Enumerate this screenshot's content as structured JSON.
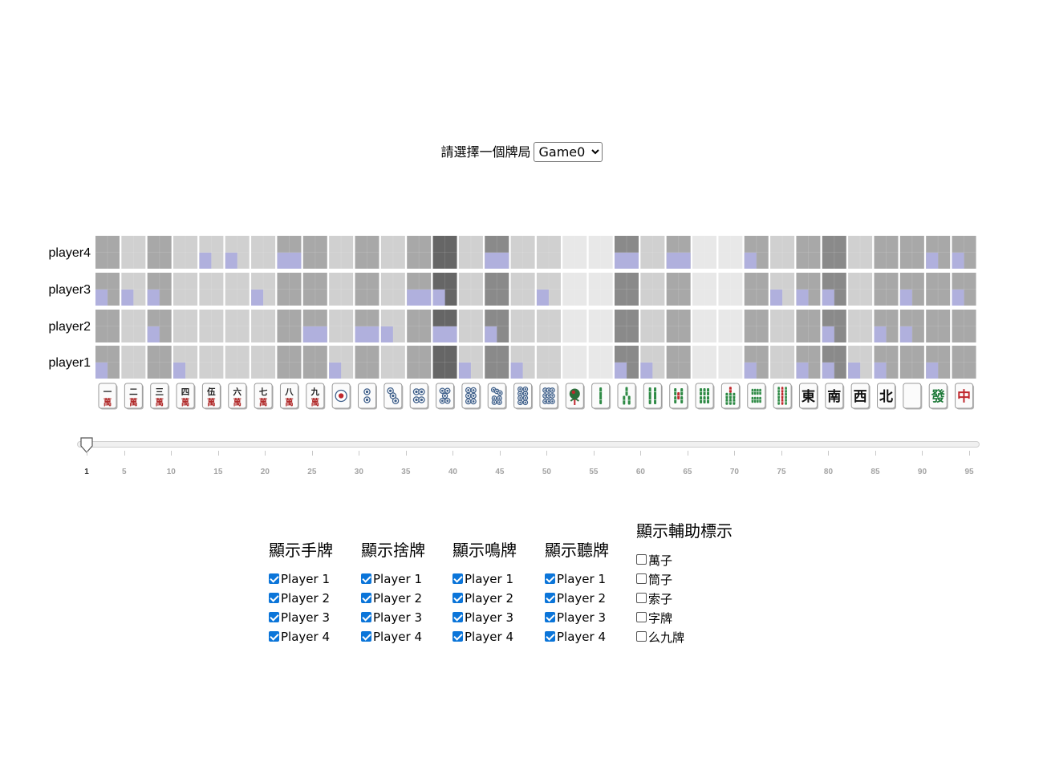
{
  "game_select": {
    "label": "請選擇一個牌局",
    "selected": "Game0",
    "options": [
      "Game0"
    ]
  },
  "heatmap": {
    "players": [
      "player4",
      "player3",
      "player2",
      "player1"
    ],
    "tiles": [
      {
        "name": "1萬",
        "top": "一",
        "bottom": "萬",
        "kind": "man"
      },
      {
        "name": "2萬",
        "top": "二",
        "bottom": "萬",
        "kind": "man"
      },
      {
        "name": "3萬",
        "top": "三",
        "bottom": "萬",
        "kind": "man"
      },
      {
        "name": "4萬",
        "top": "四",
        "bottom": "萬",
        "kind": "man"
      },
      {
        "name": "5萬",
        "top": "伍",
        "bottom": "萬",
        "kind": "man"
      },
      {
        "name": "6萬",
        "top": "六",
        "bottom": "萬",
        "kind": "man"
      },
      {
        "name": "7萬",
        "top": "七",
        "bottom": "萬",
        "kind": "man"
      },
      {
        "name": "8萬",
        "top": "八",
        "bottom": "萬",
        "kind": "man"
      },
      {
        "name": "9萬",
        "top": "九",
        "bottom": "萬",
        "kind": "man"
      },
      {
        "name": "1筒",
        "count": 1,
        "kind": "pin"
      },
      {
        "name": "2筒",
        "count": 2,
        "kind": "pin"
      },
      {
        "name": "3筒",
        "count": 3,
        "kind": "pin"
      },
      {
        "name": "4筒",
        "count": 4,
        "kind": "pin"
      },
      {
        "name": "5筒",
        "count": 5,
        "kind": "pin"
      },
      {
        "name": "6筒",
        "count": 6,
        "kind": "pin"
      },
      {
        "name": "7筒",
        "count": 7,
        "kind": "pin"
      },
      {
        "name": "8筒",
        "count": 8,
        "kind": "pin"
      },
      {
        "name": "9筒",
        "count": 9,
        "kind": "pin"
      },
      {
        "name": "1索",
        "count": 1,
        "kind": "sou"
      },
      {
        "name": "2索",
        "count": 2,
        "kind": "sou"
      },
      {
        "name": "3索",
        "count": 3,
        "kind": "sou"
      },
      {
        "name": "4索",
        "count": 4,
        "kind": "sou"
      },
      {
        "name": "5索",
        "count": 5,
        "kind": "sou"
      },
      {
        "name": "6索",
        "count": 6,
        "kind": "sou"
      },
      {
        "name": "7索",
        "count": 7,
        "kind": "sou"
      },
      {
        "name": "8索",
        "count": 8,
        "kind": "sou"
      },
      {
        "name": "9索",
        "count": 9,
        "kind": "sou"
      },
      {
        "name": "東",
        "char": "東",
        "kind": "honor",
        "color": "#111111"
      },
      {
        "name": "南",
        "char": "南",
        "kind": "honor",
        "color": "#111111"
      },
      {
        "name": "西",
        "char": "西",
        "kind": "honor",
        "color": "#111111"
      },
      {
        "name": "北",
        "char": "北",
        "kind": "honor",
        "color": "#111111"
      },
      {
        "name": "白",
        "char": "",
        "kind": "honor",
        "color": "#111111"
      },
      {
        "name": "發",
        "char": "發",
        "kind": "honor",
        "color": "#1f7a3a"
      },
      {
        "name": "中",
        "char": "中",
        "kind": "honor",
        "color": "#c0282d"
      }
    ],
    "column_shade": [
      2,
      1,
      2,
      1,
      1,
      1,
      1,
      2,
      2,
      1,
      2,
      1,
      2,
      4,
      1,
      3,
      1,
      1,
      0,
      0,
      3,
      1,
      2,
      0,
      0,
      2,
      1,
      2,
      3,
      1,
      2,
      2,
      2,
      2
    ],
    "marks": {
      "player4": [
        [
          4,
          1
        ],
        [
          5,
          1
        ],
        [
          7,
          2
        ],
        [
          15,
          2
        ],
        [
          20,
          2
        ],
        [
          22,
          2
        ],
        [
          25,
          1
        ],
        [
          32,
          1
        ],
        [
          33,
          1
        ]
      ],
      "player3": [
        [
          0,
          1
        ],
        [
          1,
          1
        ],
        [
          2,
          1
        ],
        [
          6,
          1
        ],
        [
          12,
          2
        ],
        [
          13,
          1
        ],
        [
          17,
          1
        ],
        [
          26,
          1
        ],
        [
          27,
          1
        ],
        [
          28,
          1
        ],
        [
          31,
          1
        ],
        [
          33,
          1
        ]
      ],
      "player2": [
        [
          2,
          1
        ],
        [
          8,
          2
        ],
        [
          10,
          2
        ],
        [
          11,
          1
        ],
        [
          13,
          2
        ],
        [
          15,
          1
        ],
        [
          28,
          1
        ],
        [
          30,
          1
        ],
        [
          31,
          1
        ]
      ],
      "player1": [
        [
          0,
          1
        ],
        [
          3,
          1
        ],
        [
          9,
          1
        ],
        [
          14,
          1
        ],
        [
          16,
          1
        ],
        [
          20,
          1
        ],
        [
          21,
          1
        ],
        [
          25,
          1
        ],
        [
          27,
          1
        ],
        [
          28,
          1
        ],
        [
          29,
          1
        ],
        [
          30,
          1
        ],
        [
          32,
          1
        ]
      ]
    },
    "colors": {
      "shade_0": "#e8e8e8",
      "shade_1": "#d0d0d0",
      "shade_2": "#a8a8a8",
      "shade_3": "#8a8a8a",
      "shade_4": "#666666",
      "mark": "#b0b0dd",
      "man_red": "#b02a2a",
      "pin_blue": "#3e5f8a",
      "sou_green": "#2e8a45"
    }
  },
  "slider": {
    "min": 1,
    "max": 95,
    "value": 1,
    "ticks": [
      1,
      5,
      10,
      15,
      20,
      25,
      30,
      35,
      40,
      45,
      50,
      55,
      60,
      65,
      70,
      75,
      80,
      85,
      90,
      95
    ]
  },
  "controls": [
    {
      "title": "顯示手牌",
      "options": [
        {
          "label": "Player 1",
          "checked": true
        },
        {
          "label": "Player 2",
          "checked": true
        },
        {
          "label": "Player 3",
          "checked": true
        },
        {
          "label": "Player 4",
          "checked": true
        }
      ]
    },
    {
      "title": "顯示捨牌",
      "options": [
        {
          "label": "Player 1",
          "checked": true
        },
        {
          "label": "Player 2",
          "checked": true
        },
        {
          "label": "Player 3",
          "checked": true
        },
        {
          "label": "Player 4",
          "checked": true
        }
      ]
    },
    {
      "title": "顯示鳴牌",
      "options": [
        {
          "label": "Player 1",
          "checked": true
        },
        {
          "label": "Player 2",
          "checked": true
        },
        {
          "label": "Player 3",
          "checked": true
        },
        {
          "label": "Player 4",
          "checked": true
        }
      ]
    },
    {
      "title": "顯示聽牌",
      "options": [
        {
          "label": "Player 1",
          "checked": true
        },
        {
          "label": "Player 2",
          "checked": true
        },
        {
          "label": "Player 3",
          "checked": true
        },
        {
          "label": "Player 4",
          "checked": true
        }
      ]
    },
    {
      "title": "顯示輔助標示",
      "options": [
        {
          "label": "萬子",
          "checked": false
        },
        {
          "label": "筒子",
          "checked": false
        },
        {
          "label": "索子",
          "checked": false
        },
        {
          "label": "字牌",
          "checked": false
        },
        {
          "label": "么九牌",
          "checked": false
        }
      ]
    }
  ]
}
